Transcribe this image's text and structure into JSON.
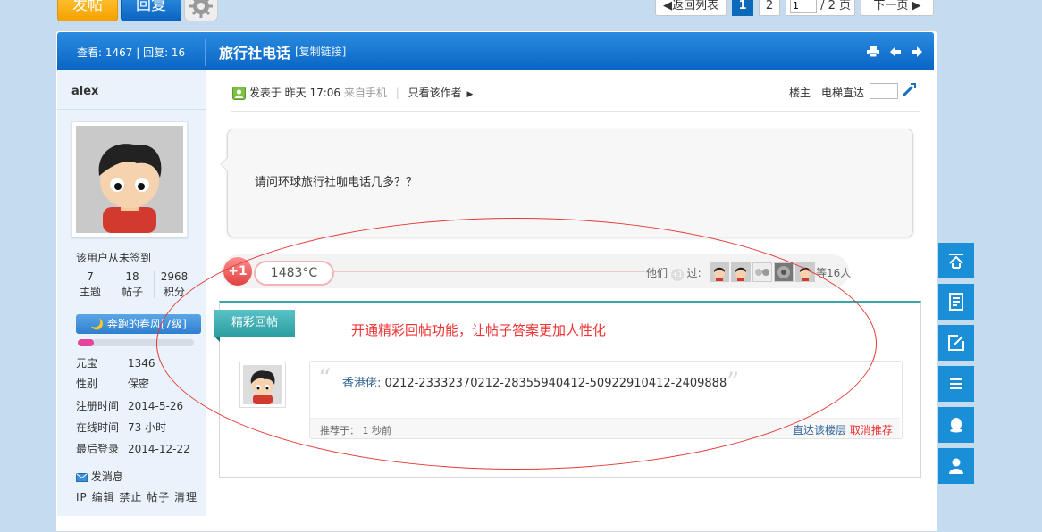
{
  "top_actions": {
    "post": "发帖",
    "reply": "回复"
  },
  "pagination": {
    "back": "◀返回列表",
    "current": "1",
    "page2": "2",
    "page_input": "1",
    "total": "/ 2 页",
    "next": "下一页 ▶"
  },
  "thread": {
    "stats": "查看: 1467 | 回复: 16",
    "title": "旅行社电话",
    "copy_link": "[复制链接]"
  },
  "user": {
    "name": "alex",
    "checkin": "该用户从未签到",
    "stats": [
      {
        "value": "7",
        "label": "主题"
      },
      {
        "value": "18",
        "label": "帖子"
      },
      {
        "value": "2968",
        "label": "积分"
      }
    ],
    "level": "🌙 奔跑的春风[7级]",
    "level_progress": 0.14,
    "profile": [
      {
        "key": "元宝",
        "value": "1346"
      },
      {
        "key": "性别",
        "value": "保密"
      },
      {
        "key": "注册时间",
        "value": "2014-5-26"
      },
      {
        "key": "在线时间",
        "value": "73 小时"
      },
      {
        "key": "最后登录",
        "value": "2014-12-22"
      }
    ],
    "send_message": "发消息",
    "tools": "IP 编辑 禁止 帖子 清理"
  },
  "post": {
    "posted": "发表于 昨天 17:06",
    "from_mobile": "来自手机",
    "only_author": "只看该作者",
    "floor_label": "楼主",
    "floor_jump": "电梯直达",
    "question": "请问环球旅行社咖电话几多？？"
  },
  "plus_one": {
    "icon": "+1",
    "temperature": "1483°C",
    "they_prefix": "他们",
    "they_suffix": "过:",
    "others": "等16人"
  },
  "highlight": {
    "tag": "精彩回帖",
    "promo": "开通精彩回帖功能，让帖子答案更加人性化",
    "reply_user": "香港佬:",
    "reply_text": "0212-23332370212-28355940412-50922910412-2409888",
    "recommended": "推荐于： 1 秒前",
    "goto_floor": "直达该楼层",
    "cancel_recommend": "取消推荐"
  },
  "colors": {
    "header": "#0a65c4",
    "accent_red": "#e33333",
    "teal": "#2b9ea2",
    "float_toolbar": "#1b8ed8"
  },
  "icons": {
    "float_toolbar": [
      "back-to-top-icon",
      "note-icon",
      "edit-icon",
      "list-icon",
      "qq-icon",
      "user-icon"
    ]
  }
}
